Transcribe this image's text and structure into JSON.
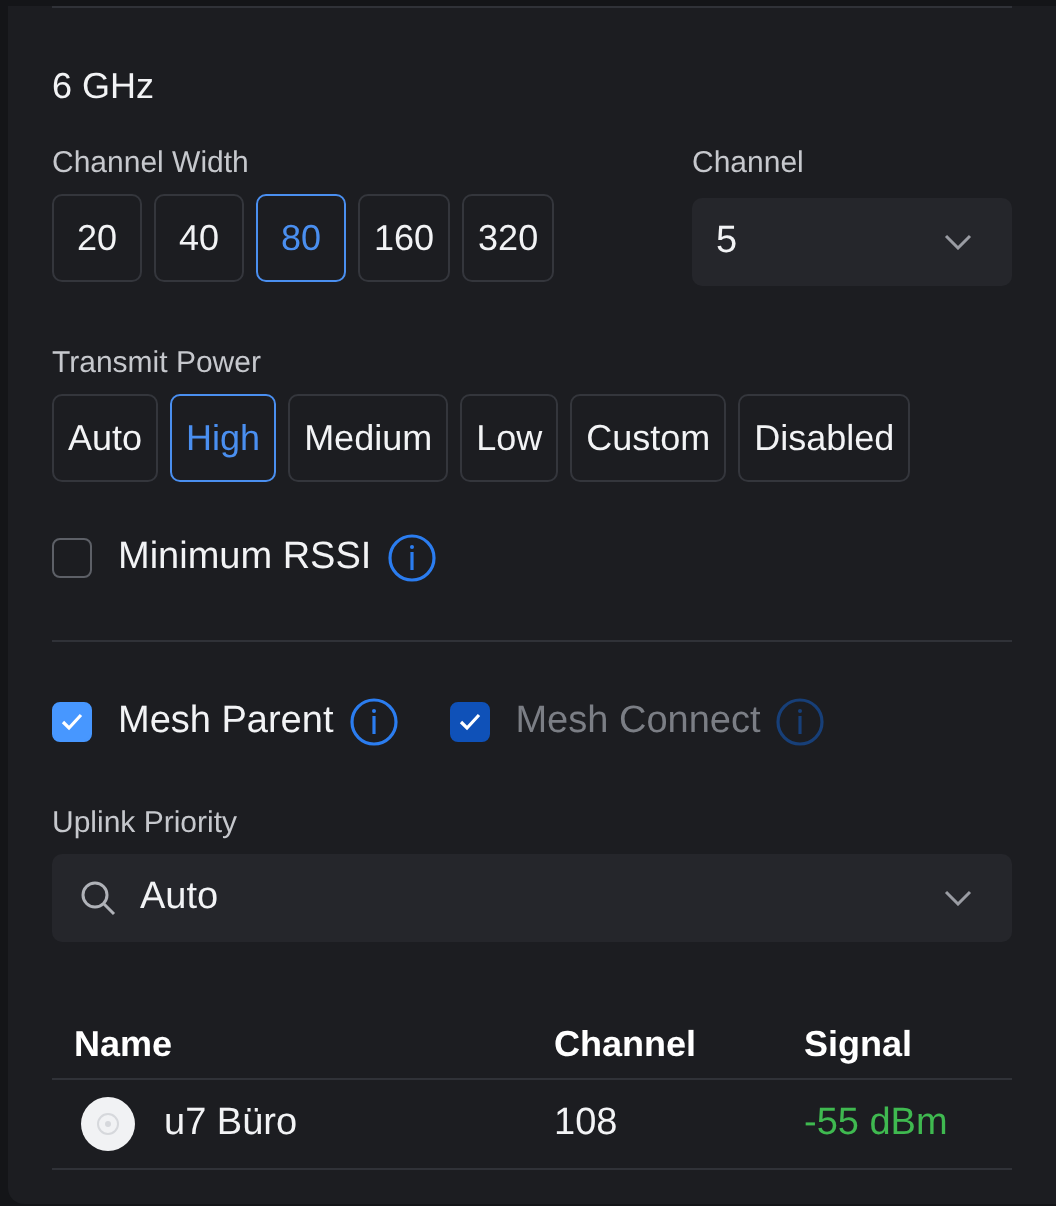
{
  "band": {
    "title": "6 GHz"
  },
  "channel_width": {
    "label": "Channel Width",
    "options": [
      {
        "label": "20",
        "selected": false
      },
      {
        "label": "40",
        "selected": false
      },
      {
        "label": "80",
        "selected": true
      },
      {
        "label": "160",
        "selected": false
      },
      {
        "label": "320",
        "selected": false
      }
    ]
  },
  "channel": {
    "label": "Channel",
    "value": "5"
  },
  "transmit_power": {
    "label": "Transmit Power",
    "options": [
      {
        "label": "Auto",
        "selected": false
      },
      {
        "label": "High",
        "selected": true
      },
      {
        "label": "Medium",
        "selected": false
      },
      {
        "label": "Low",
        "selected": false
      },
      {
        "label": "Custom",
        "selected": false
      },
      {
        "label": "Disabled",
        "selected": false
      }
    ]
  },
  "minimum_rssi": {
    "label": "Minimum RSSI",
    "checked": false,
    "disabled": false
  },
  "mesh": [
    {
      "label": "Mesh Parent",
      "checked": true,
      "disabled": false
    },
    {
      "label": "Mesh Connect",
      "checked": true,
      "disabled": true
    }
  ],
  "uplink_priority": {
    "label": "Uplink Priority",
    "value": "Auto"
  },
  "table": {
    "columns": [
      "Name",
      "Channel",
      "Signal"
    ],
    "rows": [
      {
        "name": "u7 Büro",
        "channel": "108",
        "signal": "-55 dBm",
        "color": "#3fb950"
      }
    ]
  }
}
